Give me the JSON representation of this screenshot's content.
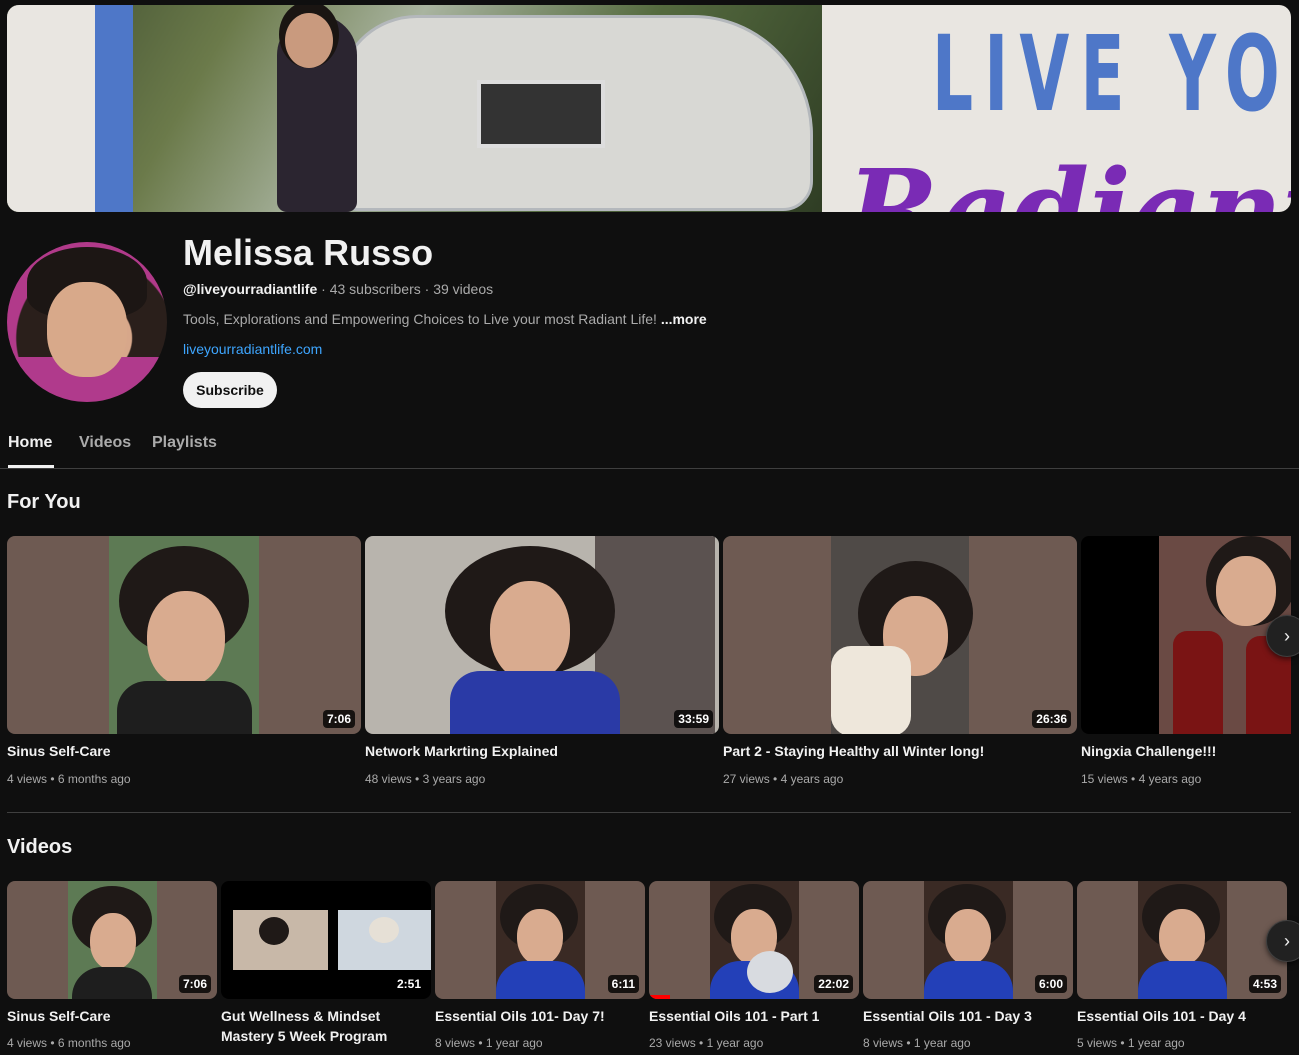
{
  "channel": {
    "name": "Melissa Russo",
    "handle": "@liveyourradiantlife",
    "subscribers": "43 subscribers",
    "video_count": "39 videos",
    "separator": " · ",
    "description": "Tools, Explorations and Empowering Choices to Live your most Radiant Life! ",
    "more_label": "...more",
    "link": "liveyourradiantlife.com",
    "subscribe_label": "Subscribe"
  },
  "banner": {
    "text_line1": "LIVE YO",
    "text_line2": "Radiant",
    "accent_blue": "#4e77c8",
    "accent_purple": "#7a2bb5"
  },
  "tabs": [
    {
      "label": "Home",
      "active": true
    },
    {
      "label": "Videos",
      "active": false
    },
    {
      "label": "Playlists",
      "active": false
    }
  ],
  "for_you": {
    "title": "For You",
    "items": [
      {
        "title": "Sinus Self-Care",
        "duration": "7:06",
        "views": "4 views",
        "age": "6 months ago"
      },
      {
        "title": "Network Markrting Explained",
        "duration": "33:59",
        "views": "48 views",
        "age": "3 years ago"
      },
      {
        "title": "Part 2 - Staying Healthy all Winter long!",
        "duration": "26:36",
        "views": "27 views",
        "age": "4 years ago"
      },
      {
        "title": "Ningxia Challenge!!!",
        "duration": "",
        "views": "15 views",
        "age": "4 years ago"
      }
    ]
  },
  "videos": {
    "title": "Videos",
    "items": [
      {
        "title": "Sinus Self-Care",
        "duration": "7:06",
        "views": "4 views",
        "age": "6 months ago"
      },
      {
        "title": "Gut Wellness & Mindset Mastery 5 Week Program",
        "duration": "2:51",
        "views": "",
        "age": ""
      },
      {
        "title": "Essential Oils 101- Day 7!",
        "duration": "6:11",
        "views": "8 views",
        "age": "1 year ago"
      },
      {
        "title": "Essential Oils 101 - Part 1",
        "duration": "22:02",
        "views": "23 views",
        "age": "1 year ago",
        "watched_fraction": 0.1
      },
      {
        "title": "Essential Oils 101 - Day 3",
        "duration": "6:00",
        "views": "8 views",
        "age": "1 year ago"
      },
      {
        "title": "Essential Oils 101 - Day 4",
        "duration": "4:53",
        "views": "5 views",
        "age": "1 year ago"
      }
    ]
  },
  "meta_dot": " • ",
  "icons": {
    "next": "chevron-right-icon"
  }
}
